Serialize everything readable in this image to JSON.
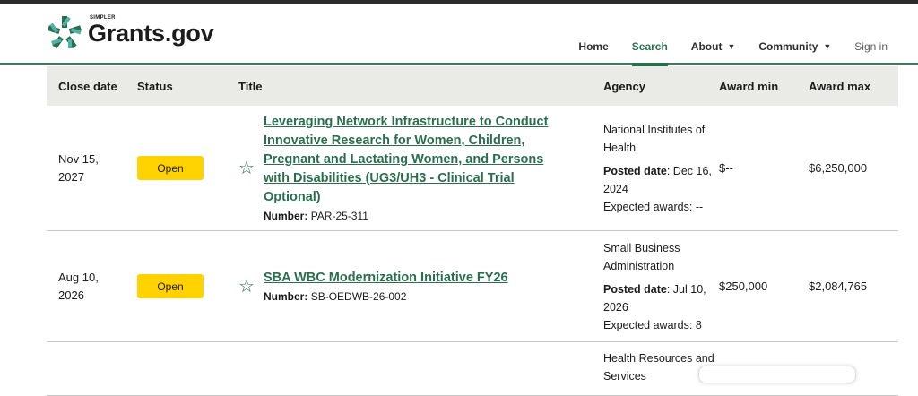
{
  "header": {
    "simpler": "SIMPLER",
    "wordmark": "Grants.gov",
    "brand_color": "#2a6f4d"
  },
  "nav": {
    "home": "Home",
    "search": "Search",
    "about": "About",
    "community": "Community",
    "signin": "Sign in",
    "active": "Search"
  },
  "table": {
    "columns": [
      "Close date",
      "Status",
      "Title",
      "Agency",
      "Award min",
      "Award max"
    ],
    "rows": [
      {
        "close_line1": "Nov 15,",
        "close_line2": "2027",
        "status": "Open",
        "title": "Leveraging Network Infrastructure to Conduct Innovative Research for Women, Children, Pregnant and Lactating Women, and Persons with Disabilities (UG3/UH3 - Clinical Trial Optional)",
        "number_label": "Number:",
        "number": "PAR-25-311",
        "agency": "National Institutes of Health",
        "posted_label": "Posted date",
        "posted": ": Dec 16, 2024",
        "expected": "Expected awards: --",
        "award_min": "$--",
        "award_max": "$6,250,000"
      },
      {
        "close_line1": "Aug 10,",
        "close_line2": "2026",
        "status": "Open",
        "title": "SBA WBC Modernization Initiative FY26",
        "number_label": "Number:",
        "number": "SB-OEDWB-26-002",
        "agency": "Small Business Administration",
        "posted_label": "Posted date",
        "posted": ": Jul 10, 2026",
        "expected": "Expected awards: 8",
        "award_min": "$250,000",
        "award_max": "$2,084,765"
      },
      {
        "agency": "Health Resources and Services"
      }
    ]
  },
  "colors": {
    "status_open": "#ffd200",
    "header_row_bg": "#eaeae6",
    "link": "#2a6f4d"
  }
}
